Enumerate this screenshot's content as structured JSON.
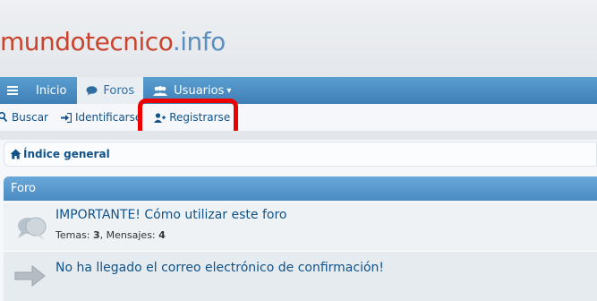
{
  "logo": {
    "brand": "mundotecnico",
    "tld": ".info"
  },
  "nav": {
    "menu_icon": "hamburger-icon",
    "items": [
      {
        "label": "Inicio",
        "icon": ""
      },
      {
        "label": "Foros",
        "icon": "chat-bubble-icon",
        "active": true
      },
      {
        "label": "Usuarios",
        "icon": "users-icon"
      }
    ],
    "dropdown_caret": "▾"
  },
  "quicklinks": [
    {
      "label": "Buscar",
      "icon": "search-icon"
    },
    {
      "label": "Identificarse",
      "icon": "sign-in-icon"
    },
    {
      "label": "Registrarse",
      "icon": "user-plus-icon"
    }
  ],
  "breadcrumb": {
    "label": "Índice general",
    "icon": "home-icon"
  },
  "forum": {
    "header": "Foro",
    "topics": [
      {
        "title": "IMPORTANTE! Cómo utilizar este foro",
        "topics_label": "Temas:",
        "topics_count": "3",
        "posts_label": "Mensajes:",
        "posts_count": "4",
        "icon": "speech-bubbles-icon"
      },
      {
        "title": "No ha llegado el correo electrónico de confirmación!",
        "icon": "arrow-right-icon"
      }
    ]
  },
  "colors": {
    "nav": "#4a8bc2",
    "highlight": "#ee0000",
    "link": "#105289",
    "brand": "#c9432d",
    "tld": "#5b8fbf"
  }
}
